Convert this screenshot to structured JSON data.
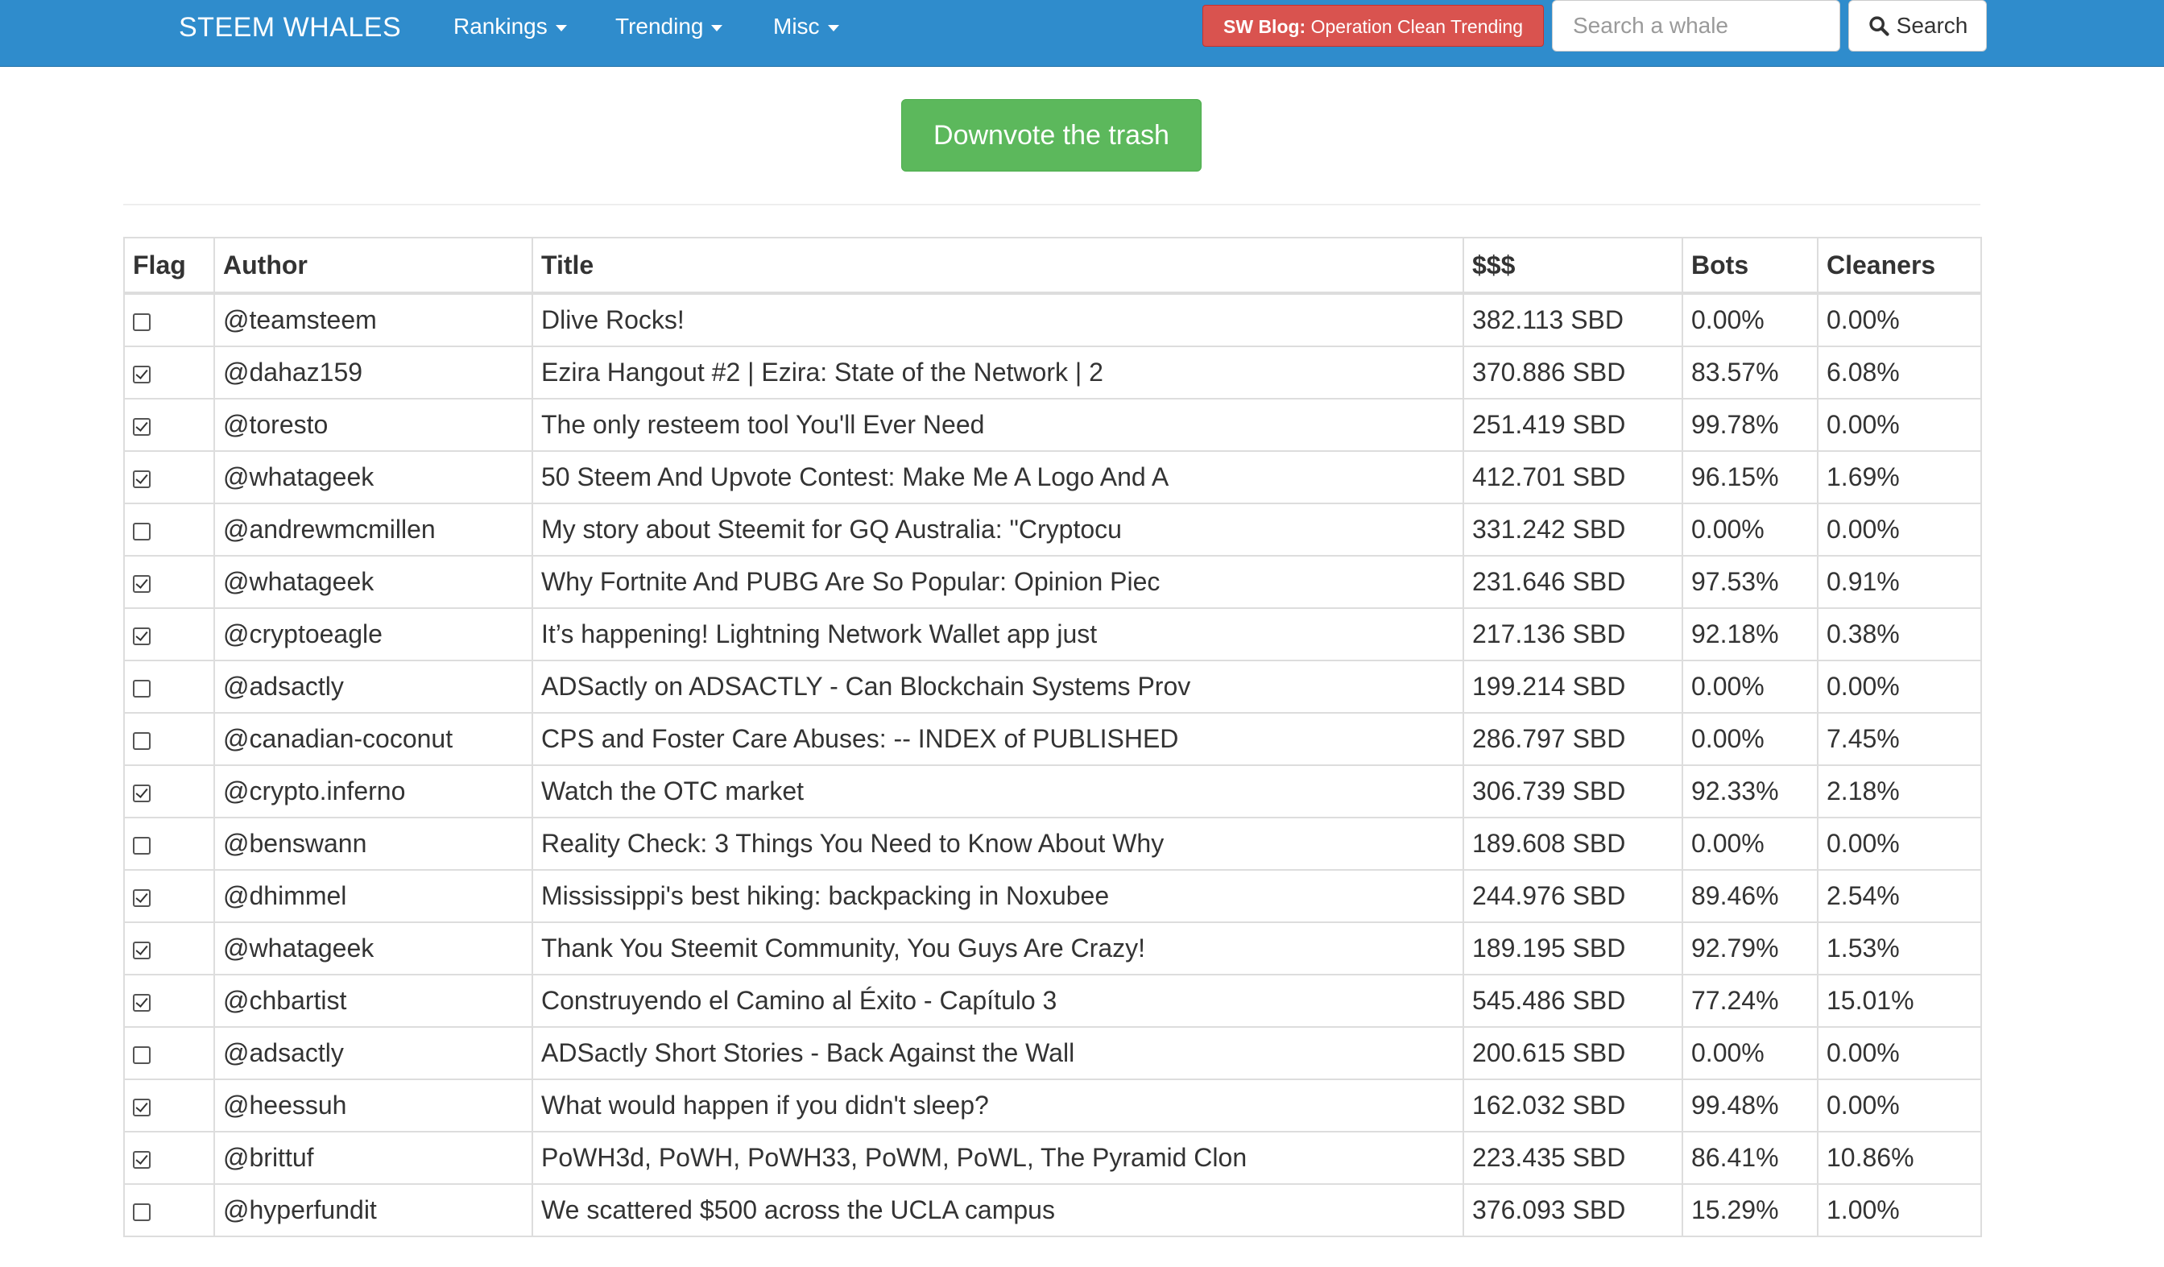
{
  "navbar": {
    "brand": "STEEM WHALES",
    "menus": [
      {
        "label": "Rankings"
      },
      {
        "label": "Trending"
      },
      {
        "label": "Misc"
      }
    ],
    "blog_prefix": "SW Blog:",
    "blog_text": "Operation Clean Trending",
    "search_placeholder": "Search a whale",
    "search_label": "Search"
  },
  "main": {
    "downvote_label": "Downvote the trash"
  },
  "table": {
    "headers": [
      "Flag",
      "Author",
      "Title",
      "$$$",
      "Bots",
      "Cleaners"
    ],
    "rows": [
      {
        "flag": false,
        "author": "@teamsteem",
        "title": "Dlive Rocks!",
        "sbd": "382.113 SBD",
        "bots": "0.00%",
        "cleaners": "0.00%"
      },
      {
        "flag": true,
        "author": "@dahaz159",
        "title": "Ezira Hangout #2 | Ezira: State of the Network | 2",
        "sbd": "370.886 SBD",
        "bots": "83.57%",
        "cleaners": "6.08%"
      },
      {
        "flag": true,
        "author": "@toresto",
        "title": "The only resteem tool You'll Ever Need",
        "sbd": "251.419 SBD",
        "bots": "99.78%",
        "cleaners": "0.00%"
      },
      {
        "flag": true,
        "author": "@whatageek",
        "title": "50 Steem And Upvote Contest: Make Me A Logo And A",
        "sbd": "412.701 SBD",
        "bots": "96.15%",
        "cleaners": "1.69%"
      },
      {
        "flag": false,
        "author": "@andrewmcmillen",
        "title": "My story about Steemit for GQ Australia: \"Cryptocu",
        "sbd": "331.242 SBD",
        "bots": "0.00%",
        "cleaners": "0.00%"
      },
      {
        "flag": true,
        "author": "@whatageek",
        "title": "Why Fortnite And PUBG Are So Popular: Opinion Piec",
        "sbd": "231.646 SBD",
        "bots": "97.53%",
        "cleaners": "0.91%"
      },
      {
        "flag": true,
        "author": "@cryptoeagle",
        "title": "It’s happening! Lightning Network Wallet app just",
        "sbd": "217.136 SBD",
        "bots": "92.18%",
        "cleaners": "0.38%"
      },
      {
        "flag": false,
        "author": "@adsactly",
        "title": "ADSactly on ADSACTLY - Can Blockchain Systems Prov",
        "sbd": "199.214 SBD",
        "bots": "0.00%",
        "cleaners": "0.00%"
      },
      {
        "flag": false,
        "author": "@canadian-coconut",
        "title": "CPS and Foster Care Abuses: -- INDEX of PUBLISHED",
        "sbd": "286.797 SBD",
        "bots": "0.00%",
        "cleaners": "7.45%"
      },
      {
        "flag": true,
        "author": "@crypto.inferno",
        "title": "Watch the OTC market",
        "sbd": "306.739 SBD",
        "bots": "92.33%",
        "cleaners": "2.18%"
      },
      {
        "flag": false,
        "author": "@benswann",
        "title": "Reality Check: 3 Things You Need to Know About Why",
        "sbd": "189.608 SBD",
        "bots": "0.00%",
        "cleaners": "0.00%"
      },
      {
        "flag": true,
        "author": "@dhimmel",
        "title": "Mississippi's best hiking: backpacking in Noxubee",
        "sbd": "244.976 SBD",
        "bots": "89.46%",
        "cleaners": "2.54%"
      },
      {
        "flag": true,
        "author": "@whatageek",
        "title": "Thank You Steemit Community, You Guys Are Crazy!",
        "sbd": "189.195 SBD",
        "bots": "92.79%",
        "cleaners": "1.53%"
      },
      {
        "flag": true,
        "author": "@chbartist",
        "title": "Construyendo el Camino al Éxito - Capítulo 3",
        "sbd": "545.486 SBD",
        "bots": "77.24%",
        "cleaners": "15.01%"
      },
      {
        "flag": false,
        "author": "@adsactly",
        "title": "ADSactly Short Stories - Back Against the Wall",
        "sbd": "200.615 SBD",
        "bots": "0.00%",
        "cleaners": "0.00%"
      },
      {
        "flag": true,
        "author": "@heessuh",
        "title": "What would happen if you didn't sleep?",
        "sbd": "162.032 SBD",
        "bots": "99.48%",
        "cleaners": "0.00%"
      },
      {
        "flag": true,
        "author": "@brittuf",
        "title": "PoWH3d, PoWH, PoWH33, PoWM, PoWL, The Pyramid Clon",
        "sbd": "223.435 SBD",
        "bots": "86.41%",
        "cleaners": "10.86%"
      },
      {
        "flag": false,
        "author": "@hyperfundit",
        "title": "We scattered $500 across the UCLA campus",
        "sbd": "376.093 SBD",
        "bots": "15.29%",
        "cleaners": "1.00%"
      }
    ]
  },
  "icons": {
    "search": "magnifier-icon",
    "dropdown": "caret-down-icon"
  },
  "colors": {
    "navbar": "#2f8ccc",
    "blog_button": "#d9534f",
    "downvote_button": "#5cb85c"
  }
}
